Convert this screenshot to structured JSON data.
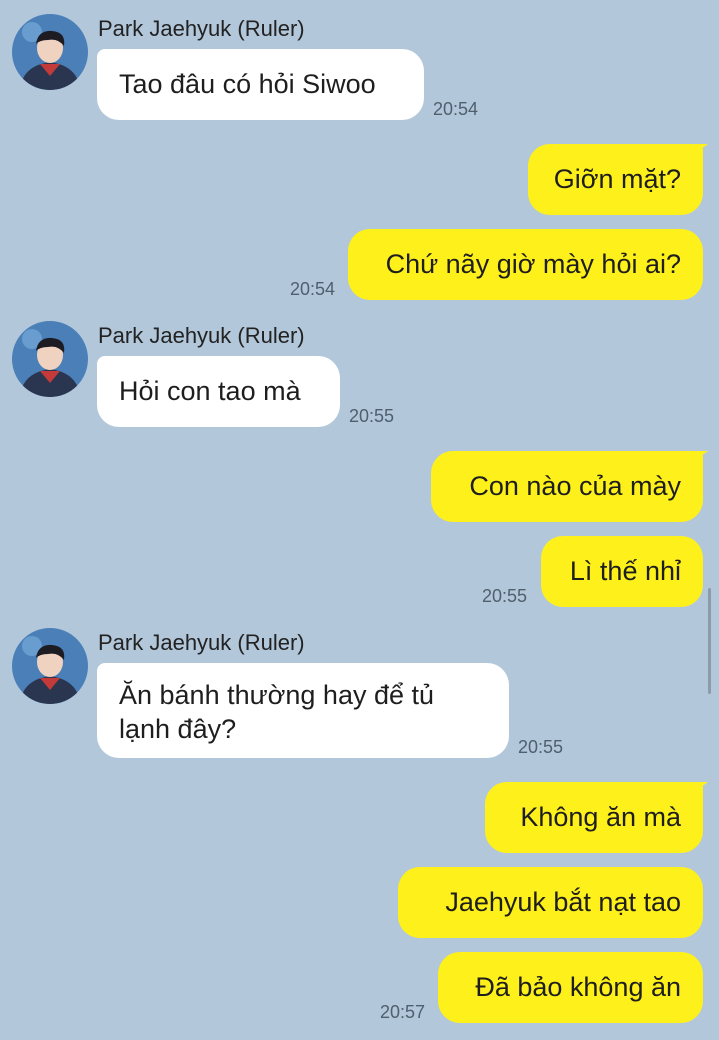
{
  "chat": {
    "sender_name": "Park Jaehyuk (Ruler)",
    "groups": [
      {
        "sender": "Park Jaehyuk (Ruler)",
        "messages": [
          "Tao đâu có hỏi Siwoo"
        ],
        "time": "20:54"
      },
      {
        "messages": [
          "Giỡn mặt?",
          "Chứ nãy giờ mày hỏi ai?"
        ],
        "time": "20:54"
      },
      {
        "sender": "Park Jaehyuk (Ruler)",
        "messages": [
          "Hỏi con tao mà"
        ],
        "time": "20:55"
      },
      {
        "messages": [
          "Con nào của mày",
          "Lì thế nhỉ"
        ],
        "time": "20:55"
      },
      {
        "sender": "Park Jaehyuk (Ruler)",
        "messages": [
          "Ăn bánh thường hay để tủ lạnh đây?"
        ],
        "time": "20:55"
      },
      {
        "messages": [
          "Không ăn mà",
          "Jaehyuk bắt nạt tao",
          "Đã bảo không ăn"
        ],
        "time": "20:57"
      }
    ]
  },
  "colors": {
    "background": "#b2c7da",
    "incoming_bubble": "#ffffff",
    "outgoing_bubble": "#fef01b"
  },
  "icons": {
    "avatar": "profile-photo"
  }
}
